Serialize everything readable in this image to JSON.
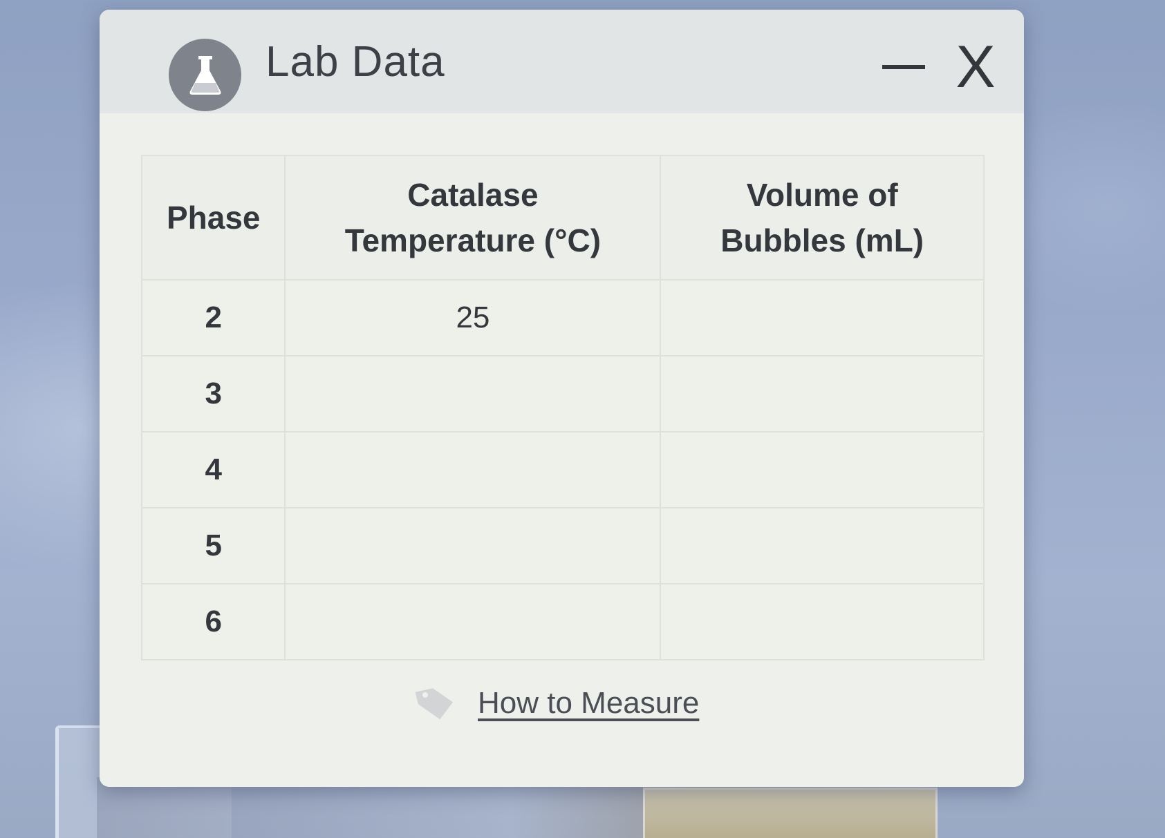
{
  "window": {
    "title": "Lab Data",
    "app_icon": "flask-icon",
    "minimize_icon": "minimize-icon",
    "close_label": "X"
  },
  "table": {
    "headers": {
      "phase": "Phase",
      "temperature_line1": "Catalase",
      "temperature_line2": "Temperature (°C)",
      "volume_line1": "Volume of",
      "volume_line2": "Bubbles (mL)"
    },
    "rows": [
      {
        "phase": "2",
        "temperature": "25",
        "volume": ""
      },
      {
        "phase": "3",
        "temperature": "",
        "volume": ""
      },
      {
        "phase": "4",
        "temperature": "",
        "volume": ""
      },
      {
        "phase": "5",
        "temperature": "",
        "volume": ""
      },
      {
        "phase": "6",
        "temperature": "",
        "volume": ""
      }
    ]
  },
  "help_link": {
    "icon": "tag-icon",
    "label": "How to Measure"
  },
  "colors": {
    "window_bg": "#e4e8e7",
    "content_bg": "#eef0ec",
    "text": "#34373c",
    "icon_circle": "#7f848c",
    "desktop": "#9aaacb"
  }
}
